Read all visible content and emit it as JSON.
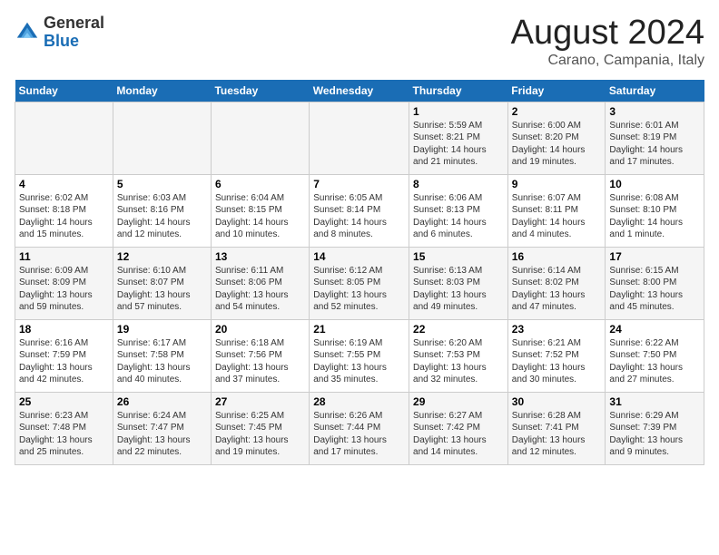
{
  "header": {
    "logo_general": "General",
    "logo_blue": "Blue",
    "month_title": "August 2024",
    "subtitle": "Carano, Campania, Italy"
  },
  "weekdays": [
    "Sunday",
    "Monday",
    "Tuesday",
    "Wednesday",
    "Thursday",
    "Friday",
    "Saturday"
  ],
  "weeks": [
    [
      {
        "day": "",
        "info": ""
      },
      {
        "day": "",
        "info": ""
      },
      {
        "day": "",
        "info": ""
      },
      {
        "day": "",
        "info": ""
      },
      {
        "day": "1",
        "info": "Sunrise: 5:59 AM\nSunset: 8:21 PM\nDaylight: 14 hours\nand 21 minutes."
      },
      {
        "day": "2",
        "info": "Sunrise: 6:00 AM\nSunset: 8:20 PM\nDaylight: 14 hours\nand 19 minutes."
      },
      {
        "day": "3",
        "info": "Sunrise: 6:01 AM\nSunset: 8:19 PM\nDaylight: 14 hours\nand 17 minutes."
      }
    ],
    [
      {
        "day": "4",
        "info": "Sunrise: 6:02 AM\nSunset: 8:18 PM\nDaylight: 14 hours\nand 15 minutes."
      },
      {
        "day": "5",
        "info": "Sunrise: 6:03 AM\nSunset: 8:16 PM\nDaylight: 14 hours\nand 12 minutes."
      },
      {
        "day": "6",
        "info": "Sunrise: 6:04 AM\nSunset: 8:15 PM\nDaylight: 14 hours\nand 10 minutes."
      },
      {
        "day": "7",
        "info": "Sunrise: 6:05 AM\nSunset: 8:14 PM\nDaylight: 14 hours\nand 8 minutes."
      },
      {
        "day": "8",
        "info": "Sunrise: 6:06 AM\nSunset: 8:13 PM\nDaylight: 14 hours\nand 6 minutes."
      },
      {
        "day": "9",
        "info": "Sunrise: 6:07 AM\nSunset: 8:11 PM\nDaylight: 14 hours\nand 4 minutes."
      },
      {
        "day": "10",
        "info": "Sunrise: 6:08 AM\nSunset: 8:10 PM\nDaylight: 14 hours\nand 1 minute."
      }
    ],
    [
      {
        "day": "11",
        "info": "Sunrise: 6:09 AM\nSunset: 8:09 PM\nDaylight: 13 hours\nand 59 minutes."
      },
      {
        "day": "12",
        "info": "Sunrise: 6:10 AM\nSunset: 8:07 PM\nDaylight: 13 hours\nand 57 minutes."
      },
      {
        "day": "13",
        "info": "Sunrise: 6:11 AM\nSunset: 8:06 PM\nDaylight: 13 hours\nand 54 minutes."
      },
      {
        "day": "14",
        "info": "Sunrise: 6:12 AM\nSunset: 8:05 PM\nDaylight: 13 hours\nand 52 minutes."
      },
      {
        "day": "15",
        "info": "Sunrise: 6:13 AM\nSunset: 8:03 PM\nDaylight: 13 hours\nand 49 minutes."
      },
      {
        "day": "16",
        "info": "Sunrise: 6:14 AM\nSunset: 8:02 PM\nDaylight: 13 hours\nand 47 minutes."
      },
      {
        "day": "17",
        "info": "Sunrise: 6:15 AM\nSunset: 8:00 PM\nDaylight: 13 hours\nand 45 minutes."
      }
    ],
    [
      {
        "day": "18",
        "info": "Sunrise: 6:16 AM\nSunset: 7:59 PM\nDaylight: 13 hours\nand 42 minutes."
      },
      {
        "day": "19",
        "info": "Sunrise: 6:17 AM\nSunset: 7:58 PM\nDaylight: 13 hours\nand 40 minutes."
      },
      {
        "day": "20",
        "info": "Sunrise: 6:18 AM\nSunset: 7:56 PM\nDaylight: 13 hours\nand 37 minutes."
      },
      {
        "day": "21",
        "info": "Sunrise: 6:19 AM\nSunset: 7:55 PM\nDaylight: 13 hours\nand 35 minutes."
      },
      {
        "day": "22",
        "info": "Sunrise: 6:20 AM\nSunset: 7:53 PM\nDaylight: 13 hours\nand 32 minutes."
      },
      {
        "day": "23",
        "info": "Sunrise: 6:21 AM\nSunset: 7:52 PM\nDaylight: 13 hours\nand 30 minutes."
      },
      {
        "day": "24",
        "info": "Sunrise: 6:22 AM\nSunset: 7:50 PM\nDaylight: 13 hours\nand 27 minutes."
      }
    ],
    [
      {
        "day": "25",
        "info": "Sunrise: 6:23 AM\nSunset: 7:48 PM\nDaylight: 13 hours\nand 25 minutes."
      },
      {
        "day": "26",
        "info": "Sunrise: 6:24 AM\nSunset: 7:47 PM\nDaylight: 13 hours\nand 22 minutes."
      },
      {
        "day": "27",
        "info": "Sunrise: 6:25 AM\nSunset: 7:45 PM\nDaylight: 13 hours\nand 19 minutes."
      },
      {
        "day": "28",
        "info": "Sunrise: 6:26 AM\nSunset: 7:44 PM\nDaylight: 13 hours\nand 17 minutes."
      },
      {
        "day": "29",
        "info": "Sunrise: 6:27 AM\nSunset: 7:42 PM\nDaylight: 13 hours\nand 14 minutes."
      },
      {
        "day": "30",
        "info": "Sunrise: 6:28 AM\nSunset: 7:41 PM\nDaylight: 13 hours\nand 12 minutes."
      },
      {
        "day": "31",
        "info": "Sunrise: 6:29 AM\nSunset: 7:39 PM\nDaylight: 13 hours\nand 9 minutes."
      }
    ]
  ]
}
